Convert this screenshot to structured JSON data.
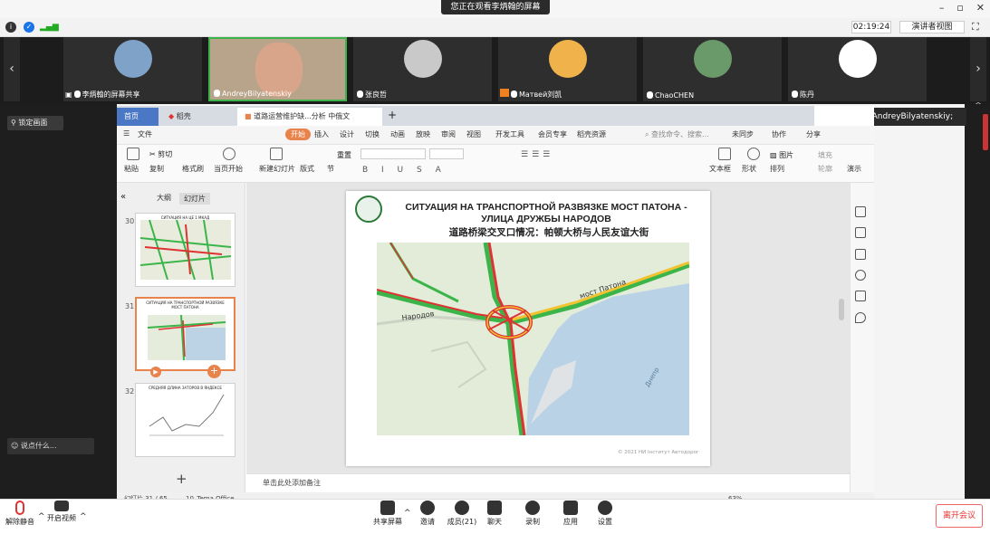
{
  "top": {
    "banner": "您正在观看李炳翰的屏幕",
    "timer": "02:19:24",
    "view_mode": "演讲者视图"
  },
  "participants": [
    {
      "name": "李炳翰的屏幕共享"
    },
    {
      "name": "AndreyBilyatenskiy"
    },
    {
      "name": "张良哲"
    },
    {
      "name": "Матвей刘凯"
    },
    {
      "name": "ChaoCHEN"
    },
    {
      "name": "陈丹"
    }
  ],
  "side": {
    "lock": "锁定画面",
    "chat_placeholder": "说点什么...",
    "speaking": "正在讲话: AndreyBilyatenskiy;"
  },
  "wps": {
    "tabs": [
      "首页",
      "稻壳",
      "道路运营维护缺...分析 中俄文"
    ],
    "menu": [
      "文件",
      "开始",
      "插入",
      "设计",
      "切换",
      "动画",
      "放映",
      "审阅",
      "视图",
      "开发工具",
      "会员专享",
      "稻壳资源"
    ],
    "search": "查找命令、搜索...",
    "sync": "未同步",
    "collab": "协作",
    "share": "分享",
    "ribbon": [
      "粘贴",
      "剪切",
      "复制",
      "格式刷",
      "当页开始",
      "新建幻灯片",
      "版式",
      "节",
      "重置",
      "文本框",
      "形状",
      "图片",
      "排列",
      "填充",
      "轮廓",
      "演示"
    ],
    "panel_tabs": [
      "大纲",
      "幻灯片"
    ],
    "slide_numbers": [
      "30",
      "31",
      "32"
    ],
    "thumb30_title": "СИТУАЦИЯ НА ЦЕ 1 МКАД",
    "thumb31_title": "СИТУАЦИЯ НА ТРАНСПОРТНОЙ РАЗВЯЗКЕ МОСТ ПАТОНА",
    "thumb32_title": "СРЕДНЯЯ ДЛИНА ЗАТОРОВ В ЯНДЕКСЕ",
    "slide_title_ru": "СИТУАЦИЯ НА ТРАНСПОРТНОЙ РАЗВЯЗКЕ  МОСТ ПАТОНА - УЛИЦА ДРУЖБЫ НАРОДОВ",
    "slide_title_cn": "道路桥梁交叉口情况：帕顿大桥与人民友谊大街",
    "map_label_bridge": "мост Патона",
    "map_label_road": "Народов",
    "map_label_river": "Днепр",
    "copyright": "© 2021 НИ Інститут Автодорог",
    "notes": "单击此处添加备注",
    "status_slide": "幻灯片 31 / 65",
    "status_theme": "10_Tema Office",
    "zoom": "63%"
  },
  "bottom": {
    "unmute": "解除静音",
    "video": "开启视频",
    "share": "共享屏幕",
    "invite": "邀请",
    "members": "成员(21)",
    "chat": "聊天",
    "record": "录制",
    "apps": "应用",
    "settings": "设置",
    "leave": "离开会议"
  }
}
